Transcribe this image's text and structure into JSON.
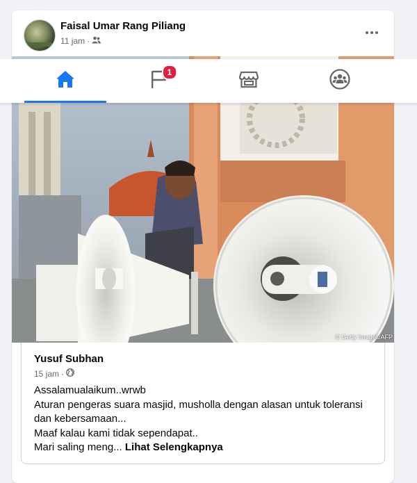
{
  "post": {
    "author": "Faisal Umar Rang Piliang",
    "time": "11 jam",
    "separator": "·",
    "privacy_icon": "friends-icon",
    "more_icon": "more-horizontal-icon",
    "image_credit": "© Getty Images/AFP"
  },
  "nav": {
    "tabs": [
      {
        "name": "home",
        "icon": "home-icon",
        "active": true
      },
      {
        "name": "pages",
        "icon": "flag-icon",
        "badge": "1"
      },
      {
        "name": "marketplace",
        "icon": "marketplace-icon"
      },
      {
        "name": "groups",
        "icon": "groups-icon"
      }
    ],
    "accent": "#1877f2",
    "badge_color": "#e41e3f"
  },
  "shared": {
    "author": "Yusuf Subhan",
    "time": "15 jam",
    "separator": "·",
    "privacy_icon": "globe-icon",
    "lines": [
      "Assalamualaikum..wrwb",
      "Aturan pengeras suara masjid, musholla dengan alasan untuk toleransi",
      "dan kebersamaan...",
      "Maaf kalau kami tidak sependapat..",
      "Mari saling meng..."
    ],
    "see_more": "Lihat Selengkapnya"
  }
}
